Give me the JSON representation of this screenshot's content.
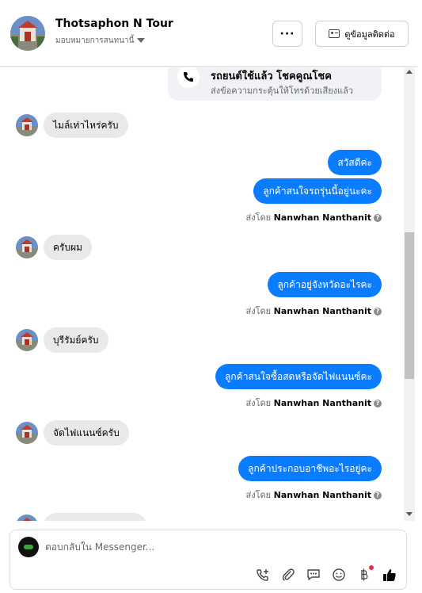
{
  "header": {
    "contact_name": "Thotsaphon N Tour",
    "assign_label": "มอบหมายการสนทนานี้",
    "more_label": "···",
    "contact_info_label": "ดูข้อมูลติดต่อ"
  },
  "call_card": {
    "title": "รถยนต์ใช้แล้ว โชคคูณโชค",
    "subtitle": "ส่งข้อความกระตุ้นให้โทรด้วยเสียงแล้ว"
  },
  "messages": [
    {
      "dir": "in",
      "text": "ไมล์เท่าไหร่ครับ"
    },
    {
      "dir": "out",
      "text": "สวัสดีค่ะ"
    },
    {
      "dir": "out",
      "text": "ลูกค้าสนใจรถรุ่นนี้อยู่นะคะ"
    },
    {
      "dir": "in",
      "text": "ครับผม"
    },
    {
      "dir": "out",
      "text": "ลูกค้าอยู่จังหวัดอะไรคะ"
    },
    {
      "dir": "in",
      "text": "บุรีรัมย์ครับ"
    },
    {
      "dir": "out",
      "text": "ลูกค้าสนใจซื้อสดหรือจัดไฟแนนซ์คะ"
    },
    {
      "dir": "in",
      "text": "จัดไฟแนนซ์ครับ"
    },
    {
      "dir": "out",
      "text": "ลูกค้าประกอบอาชีพอะไรอยู่คะ"
    }
  ],
  "sent_by": {
    "prefix": "ส่งโดย",
    "name": "Nanwhan Nanthanit",
    "help": "?"
  },
  "composer": {
    "placeholder": "ตอบกลับใน Messenger..."
  },
  "tools": [
    "phone-plus-icon",
    "paperclip-icon",
    "saved-reply-icon",
    "emoji-icon",
    "baht-icon",
    "like-icon"
  ],
  "colors": {
    "outgoing_bubble": "#0a7cff",
    "incoming_bubble": "#e9e9eb",
    "notification_dot": "#f02849"
  }
}
